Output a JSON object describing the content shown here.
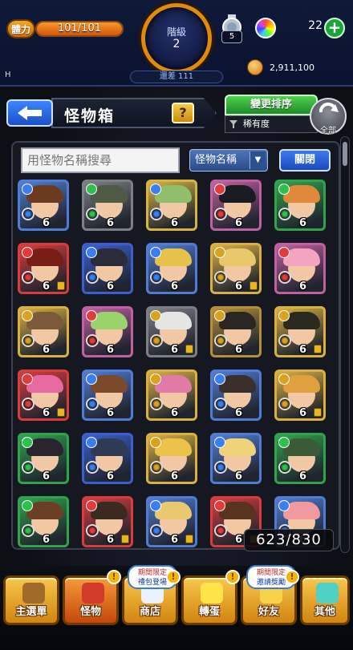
{
  "status": {
    "stamina_label": "體力",
    "stamina_text": "101/101",
    "stamina_fraction": 1.0,
    "rank_label": "階級",
    "rank_value": "2",
    "rank_diff": "還差 111",
    "potion_count": "5",
    "orb_count": "22",
    "coins": "2,911,100",
    "corner_letter": "H"
  },
  "header": {
    "title": "怪物箱",
    "help_label": "?",
    "sort_label": "變更排序",
    "sort_mode": "稀有度",
    "all_label": "全部"
  },
  "search": {
    "placeholder": "用怪物名稱搜尋",
    "select_value": "怪物名稱",
    "close_label": "關閉"
  },
  "box_count": "623/830",
  "grid": {
    "level_text": "6",
    "rows": [
      [
        {
          "frame": "#4f7dd6",
          "hair": "#6b3a1f",
          "el": "#3b7ef0",
          "lock": false
        },
        {
          "frame": "#7d7f86",
          "hair": "#4e5a45",
          "el": "#2fbf4b",
          "lock": false
        },
        {
          "frame": "#d7b341",
          "hair": "#8fbf6a",
          "el": "#3b7ef0",
          "lock": false
        },
        {
          "frame": "#c060a0",
          "hair": "#1b1b24",
          "el": "#e23b3b",
          "lock": false
        },
        {
          "frame": "#2fa44b",
          "hair": "#e2883a",
          "el": "#2fbf4b",
          "lock": false
        }
      ],
      [
        {
          "frame": "#d83c3c",
          "hair": "#7a1d17",
          "el": "#e23b3b",
          "lock": true
        },
        {
          "frame": "#3a5fd0",
          "hair": "#2a2d39",
          "el": "#3b7ef0",
          "lock": false
        },
        {
          "frame": "#4f7dd6",
          "hair": "#e6c24a",
          "el": "#3b7ef0",
          "lock": false
        },
        {
          "frame": "#d9b041",
          "hair": "#e8c86a",
          "el": "#d9a320",
          "lock": true
        },
        {
          "frame": "#c060a0",
          "hair": "#f2a4c0",
          "el": "#e23b3b",
          "lock": false
        }
      ],
      [
        {
          "frame": "#d9b041",
          "hair": "#7a5a3a",
          "el": "#d9a320",
          "lock": false
        },
        {
          "frame": "#c060a0",
          "hair": "#9ad36b",
          "el": "#e23b3b",
          "lock": false
        },
        {
          "frame": "#7d7f86",
          "hair": "#e5e5e5",
          "el": "#d9a320",
          "lock": true
        },
        {
          "frame": "#b78f3a",
          "hair": "#2a2722",
          "el": "#d9a320",
          "lock": false
        },
        {
          "frame": "#d9b041",
          "hair": "#2b2a20",
          "el": "#d9a320",
          "lock": true
        }
      ],
      [
        {
          "frame": "#d83c3c",
          "hair": "#e86aa0",
          "el": "#e23b3b",
          "lock": true
        },
        {
          "frame": "#4f7dd6",
          "hair": "#7a4a2a",
          "el": "#3b7ef0",
          "lock": false
        },
        {
          "frame": "#d9b041",
          "hair": "#e27aa8",
          "el": "#d9a320",
          "lock": false
        },
        {
          "frame": "#4f7dd6",
          "hair": "#3a2f2a",
          "el": "#3b7ef0",
          "lock": false
        },
        {
          "frame": "#d9b041",
          "hair": "#e0a040",
          "el": "#d9a320",
          "lock": true
        }
      ],
      [
        {
          "frame": "#2fa44b",
          "hair": "#2a2430",
          "el": "#2fbf4b",
          "lock": false
        },
        {
          "frame": "#3a5fd0",
          "hair": "#2f3a55",
          "el": "#3b7ef0",
          "lock": false
        },
        {
          "frame": "#d9b041",
          "hair": "#ecc24a",
          "el": "#d9a320",
          "lock": false
        },
        {
          "frame": "#4f7dd6",
          "hair": "#f0d27a",
          "el": "#3b7ef0",
          "lock": false
        },
        {
          "frame": "#2fa44b",
          "hair": "#3a5a3a",
          "el": "#2fbf4b",
          "lock": false
        }
      ],
      [
        {
          "frame": "#2fa44b",
          "hair": "#6b3f25",
          "el": "#2fbf4b",
          "lock": false
        },
        {
          "frame": "#d83c3c",
          "hair": "#3a2a20",
          "el": "#e23b3b",
          "lock": true
        },
        {
          "frame": "#4f7dd6",
          "hair": "#e9c870",
          "el": "#3b7ef0",
          "lock": true
        },
        {
          "frame": "#d83c3c",
          "hair": "#5a3320",
          "el": "#e23b3b",
          "lock": true
        },
        {
          "frame": "#4f7dd6",
          "hair": "#f09aa0",
          "el": "#3b7ef0",
          "lock": false
        }
      ]
    ]
  },
  "nav": {
    "items": [
      {
        "label": "主選單",
        "active": false,
        "icon": "#a06a2a"
      },
      {
        "label": "怪物",
        "active": true,
        "icon": "#d23a2a"
      },
      {
        "label": "商店",
        "active": false,
        "icon": "#e8f2ff"
      },
      {
        "label": "轉蛋",
        "active": false,
        "icon": "#ffe34a"
      },
      {
        "label": "好友",
        "active": false,
        "icon": "#f7d24a"
      },
      {
        "label": "其他",
        "active": false,
        "icon": "#4fd1c5"
      }
    ],
    "shop_bubble_top": "期間限定",
    "shop_bubble_bottom": "禮包登場",
    "friend_bubble_top": "期間限定",
    "friend_bubble_bottom": "邀請獎勵",
    "warn_mark": "!"
  }
}
